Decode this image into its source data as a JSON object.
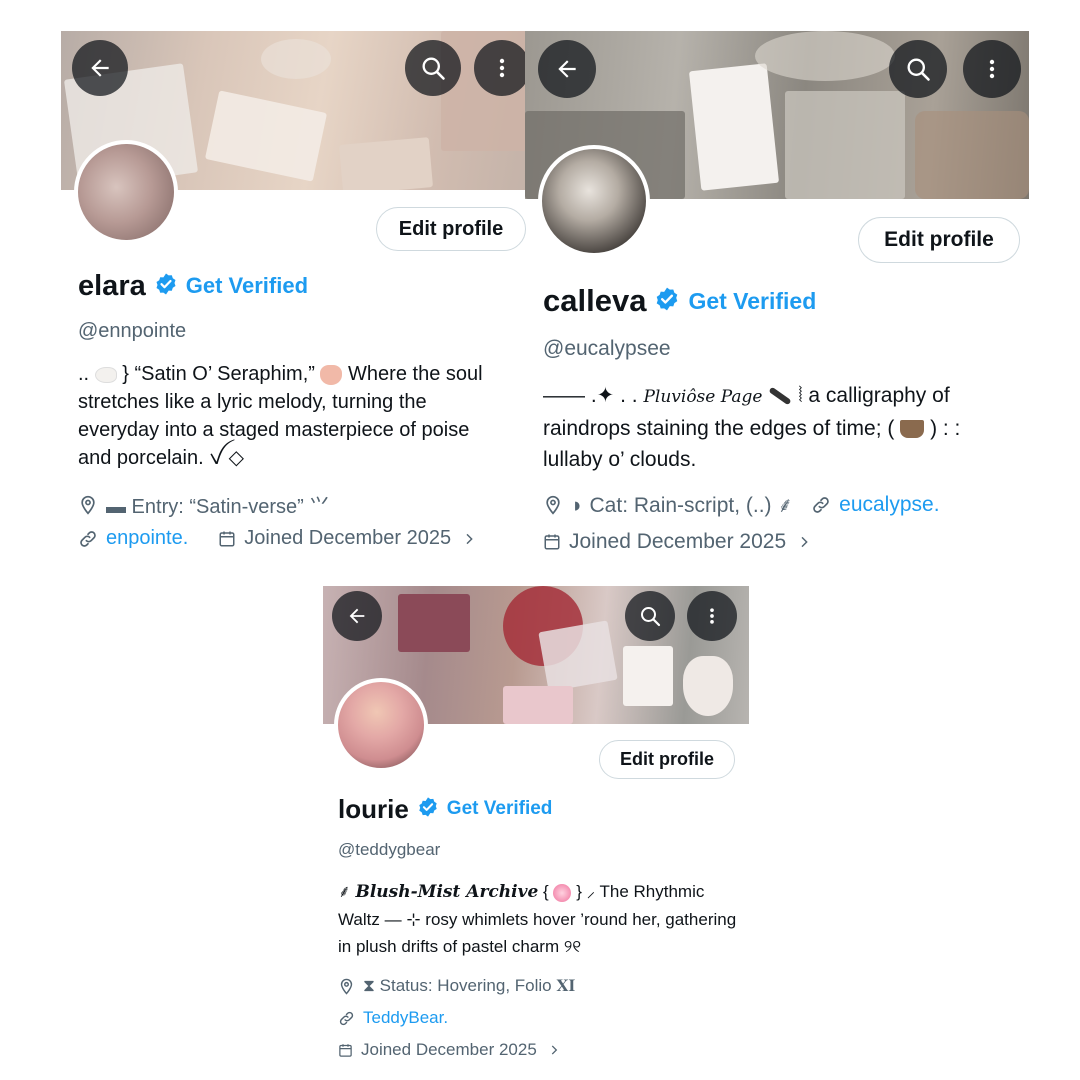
{
  "profiles": [
    {
      "name": "elara",
      "verify_label": "Get Verified",
      "handle": "@ennpointe",
      "edit_label": "Edit profile",
      "bio": {
        "p1": "..",
        "p2": "} “Satin  O’  Seraphim,”",
        "p3": "Where the soul stretches like a lyric melody, turning the everyday into a staged masterpiece of poise and porcelain. ꪜ ◇"
      },
      "location": "▬ Entry: “Satin-verse” ⺍",
      "link": "enpointe.",
      "joined": "Joined December 2025",
      "colors": {
        "banner": "#cdb9ad",
        "avatar": "#b79a95"
      }
    },
    {
      "name": "calleva",
      "verify_label": "Get Verified",
      "handle": "@eucalypsee",
      "edit_label": "Edit profile",
      "bio": {
        "p1": "—— .✦ . .",
        "p2": "Pluviôse  Page",
        "p3": "⦚ a calligraphy of raindrops staining the edges of time; (",
        "p4": ") : : lullaby  o’  clouds."
      },
      "location": "◗ Cat: Rain-script, (..) ⸙",
      "link": "eucalypse.",
      "joined": "Joined December 2025",
      "colors": {
        "banner": "#8d8a84",
        "avatar": "#9c958e"
      }
    },
    {
      "name": "lourie",
      "verify_label": "Get Verified",
      "handle": "@teddygbear",
      "edit_label": "Edit profile",
      "bio": {
        "p1": "⸙",
        "p2": "Blush-Mist Archive",
        "p3": "{",
        "p4": "} ⸝ The Rhythmic Waltz — ⊹ rosy whimlets hover ’round her, gathering in plush drifts of pastel charm ୨୧"
      },
      "location": "⧗ Status: Hovering, Folio 𝐗𝐈",
      "link": "TeddyBear.",
      "joined": "Joined December 2025",
      "colors": {
        "banner": "#b29a9d",
        "avatar": "#d8a3a6"
      }
    }
  ],
  "icons": [
    "back-arrow-icon",
    "search-icon",
    "more-vertical-icon",
    "verified-badge-icon",
    "location-pin-icon",
    "link-icon",
    "calendar-icon",
    "chevron-right-icon"
  ],
  "accent": "#1d9bf0"
}
